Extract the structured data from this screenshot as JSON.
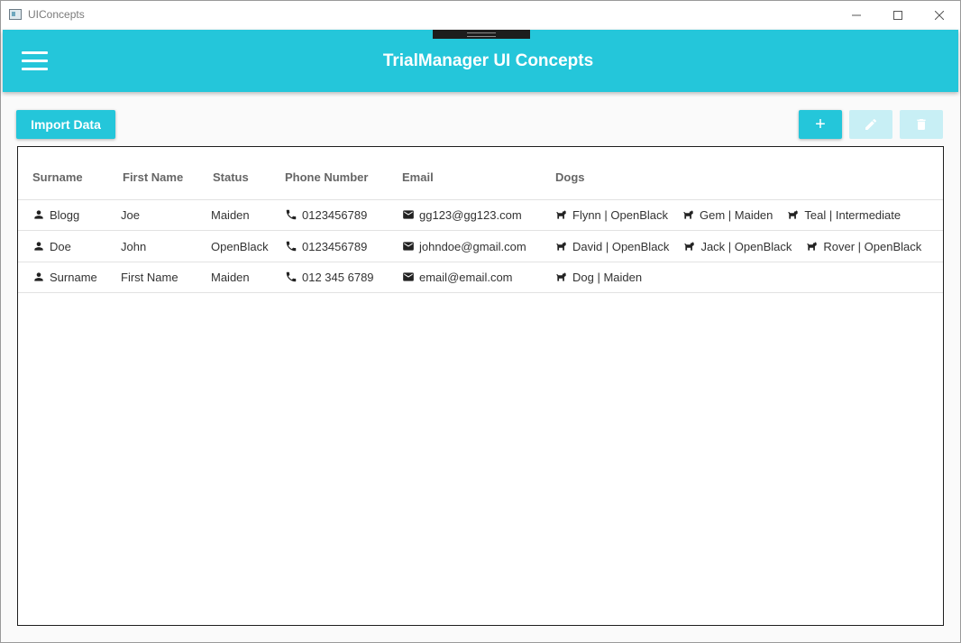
{
  "window": {
    "title": "UIConcepts"
  },
  "appbar": {
    "title": "TrialManager UI Concepts"
  },
  "toolbar": {
    "import_label": "Import Data",
    "add_label": "+"
  },
  "table": {
    "columns": [
      "Surname",
      "First Name",
      "Status",
      "Phone Number",
      "Email",
      "Dogs"
    ],
    "rows": [
      {
        "surname": "Blogg",
        "first_name": "Joe",
        "status": "Maiden",
        "phone": "0123456789",
        "email": "gg123@gg123.com",
        "dogs": [
          "Flynn | OpenBlack",
          "Gem | Maiden",
          "Teal | Intermediate"
        ]
      },
      {
        "surname": "Doe",
        "first_name": "John",
        "status": "OpenBlack",
        "phone": "0123456789",
        "email": "johndoe@gmail.com",
        "dogs": [
          "David | OpenBlack",
          "Jack | OpenBlack",
          "Rover | OpenBlack"
        ]
      },
      {
        "surname": "Surname",
        "first_name": "First Name",
        "status": "Maiden",
        "phone": "012 345 6789",
        "email": "email@email.com",
        "dogs": [
          "Dog | Maiden"
        ]
      }
    ]
  },
  "colors": {
    "accent": "#24c6da",
    "accent_disabled": "#c8eff5"
  }
}
